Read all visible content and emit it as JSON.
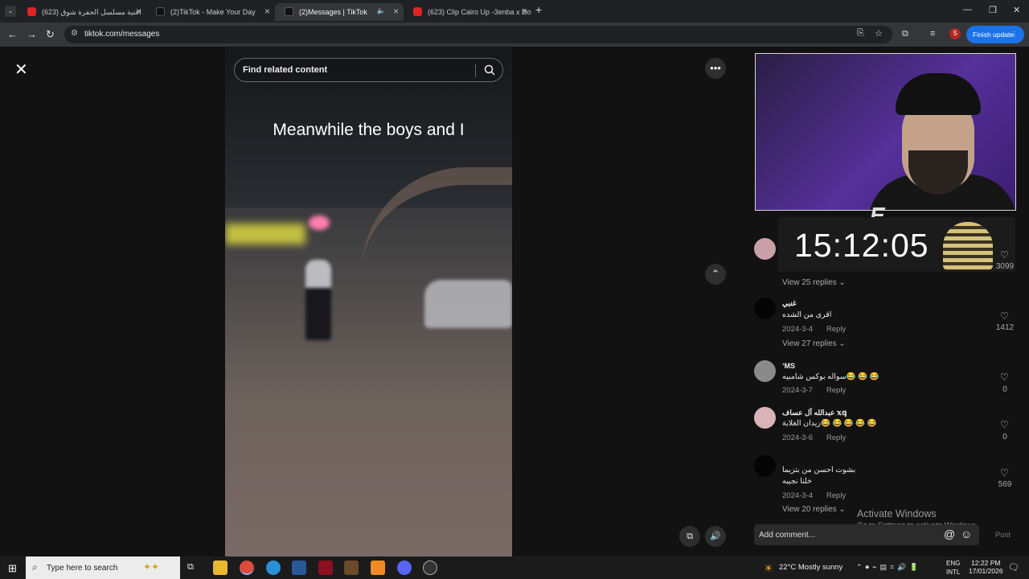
{
  "browser": {
    "tabs": [
      {
        "title": "اغنية مسلسل الحفرة شوق (623)",
        "favicon": "youtube-icon",
        "active": false
      },
      {
        "title": "(2)TikTok - Make Your Day",
        "favicon": "tiktok-icon",
        "active": false
      },
      {
        "title": "(2)Messages | TikTok",
        "favicon": "tiktok-icon",
        "active": true,
        "playing_audio": true
      },
      {
        "title": "(623) Clip Cairo Up -3enba x Do",
        "favicon": "youtube-icon",
        "active": false
      }
    ],
    "url": "tiktok.com/messages",
    "finish_update_label": "Finish update",
    "profile_initial": "S"
  },
  "video": {
    "search_placeholder": "Find related content",
    "caption": "Meanwhile the boys and I"
  },
  "overlay": {
    "clock": "15:12:05",
    "logo_letter": "E"
  },
  "comments": {
    "items": [
      {
        "user": "",
        "text": "",
        "date": "",
        "likes": "3099",
        "view_replies": "View 25 replies"
      },
      {
        "user": "غنبي",
        "text": "اقرى من الشده",
        "date": "2024-3-4",
        "reply": "Reply",
        "likes": "1412",
        "view_replies": "View 27 replies"
      },
      {
        "user": "ʼMS",
        "text": "سواله بوكس شامبيه😂 😂 😂",
        "date": "2024-3-7",
        "reply": "Reply",
        "likes": "0"
      },
      {
        "user": "عبدالله آل عساف 𝕩𝕢",
        "text": "زيدان الغلابة😂 😂 😂 😂 😂",
        "date": "2024-3-6",
        "reply": "Reply",
        "likes": "0"
      },
      {
        "user": "",
        "text1": "بشوت احسن من بتزيما",
        "text2": "خلنا نجيبه",
        "date": "2024-3-4",
        "reply": "Reply",
        "likes": "569",
        "view_replies": "View 20 replies"
      }
    ],
    "add_placeholder": "Add comment...",
    "post_label": "Post"
  },
  "activate_windows": {
    "title": "Activate Windows",
    "subtitle": "Go to Settings to activate Windows."
  },
  "taskbar": {
    "search_placeholder": "Type here to search",
    "weather": "22°C  Mostly sunny",
    "lang_top": "ENG",
    "lang_bottom": "INTL",
    "time": "12:22 PM",
    "date": "17/01/2026"
  },
  "colors": {
    "accent": "#1a73e8",
    "youtube": "#e02424"
  }
}
